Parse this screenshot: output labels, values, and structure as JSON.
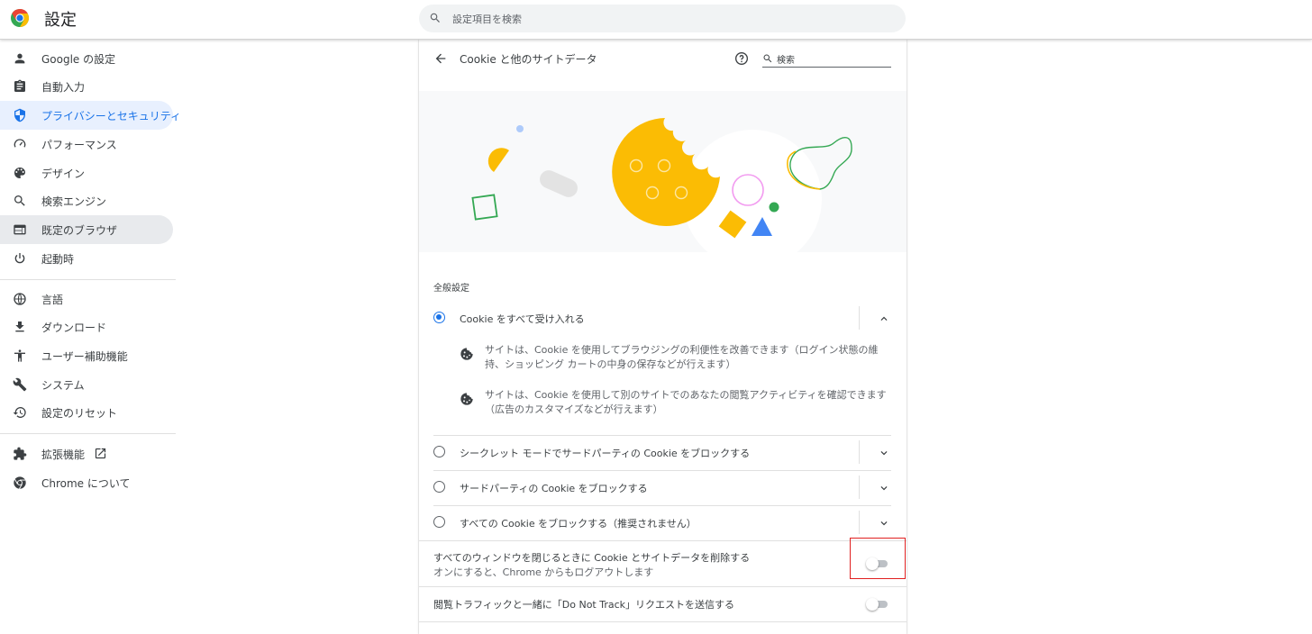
{
  "app": {
    "title": "設定"
  },
  "search": {
    "placeholder": "設定項目を検索"
  },
  "sidebar": {
    "items": [
      {
        "label": "Google の設定",
        "icon": "person-icon"
      },
      {
        "label": "自動入力",
        "icon": "clipboard-icon"
      },
      {
        "label": "プライバシーとセキュリティ",
        "icon": "shield-icon",
        "selected": true
      },
      {
        "label": "パフォーマンス",
        "icon": "speedometer-icon"
      },
      {
        "label": "デザイン",
        "icon": "palette-icon"
      },
      {
        "label": "検索エンジン",
        "icon": "search-icon"
      },
      {
        "label": "既定のブラウザ",
        "icon": "browser-icon"
      },
      {
        "label": "起動時",
        "icon": "power-icon"
      },
      {
        "label": "言語",
        "icon": "globe-icon"
      },
      {
        "label": "ダウンロード",
        "icon": "download-icon"
      },
      {
        "label": "ユーザー補助機能",
        "icon": "accessibility-icon"
      },
      {
        "label": "システム",
        "icon": "wrench-icon"
      },
      {
        "label": "設定のリセット",
        "icon": "restore-icon"
      },
      {
        "label": "拡張機能",
        "icon": "puzzle-icon"
      },
      {
        "label": "Chrome について",
        "icon": "chrome-icon"
      }
    ]
  },
  "page": {
    "title": "Cookie と他のサイトデータ",
    "search_placeholder": "検索",
    "section_title": "全般設定",
    "options": [
      {
        "label": "Cookie をすべて受け入れる",
        "selected": true
      },
      {
        "label": "シークレット モードでサードパーティの Cookie をブロックする",
        "selected": false
      },
      {
        "label": "サードパーティの Cookie をブロックする",
        "selected": false
      },
      {
        "label": "すべての Cookie をブロックする（推奨されません）",
        "selected": false
      }
    ],
    "info_lines": [
      "サイトは、Cookie を使用してブラウジングの利便性を改善できます（ログイン状態の維持、ショッピング カートの中身の保存などが行えます）",
      "サイトは、Cookie を使用して別のサイトでのあなたの閲覧アクティビティを確認できます（広告のカスタマイズなどが行えます）"
    ],
    "clear_on_exit": {
      "title": "すべてのウィンドウを閉じるときに Cookie とサイトデータを削除する",
      "subtitle": "オンにすると、Chrome からもログアウトします",
      "enabled": false
    },
    "do_not_track": {
      "title": "閲覧トラフィックと一緒に「Do Not Track」リクエストを送信する",
      "enabled": false
    }
  },
  "colors": {
    "accent": "#1a73e8",
    "cookie": "#fbbc04",
    "green": "#34a853",
    "highlight": "#e02020"
  }
}
